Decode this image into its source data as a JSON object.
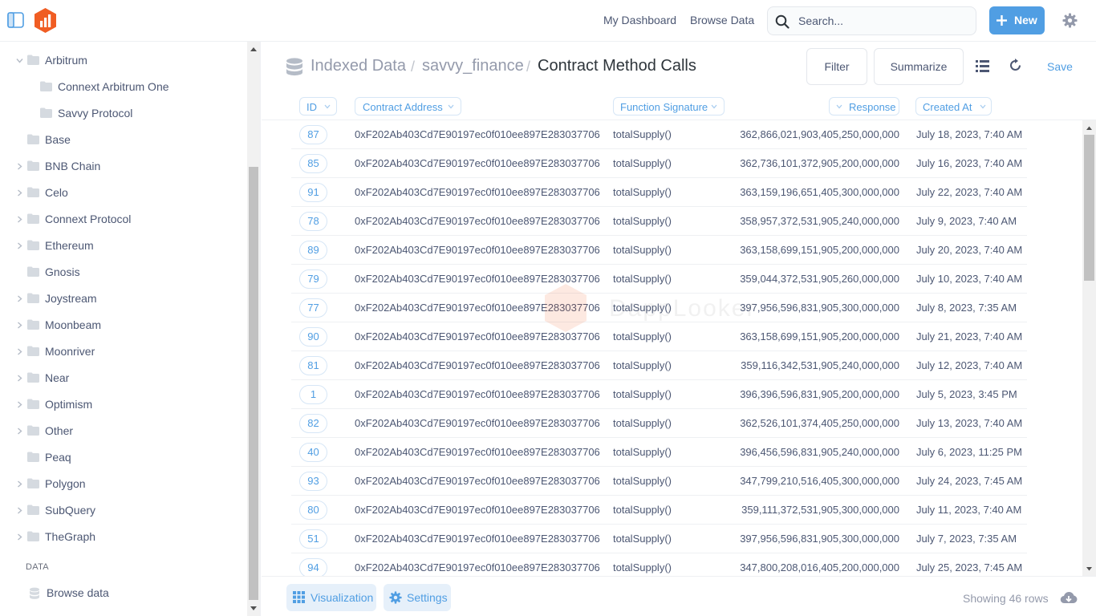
{
  "topbar": {
    "nav": [
      "My Dashboard",
      "Browse Data"
    ],
    "search_placeholder": "Search...",
    "new_label": "New",
    "brand_color": "#509ee3",
    "logo_color": "#f05d23"
  },
  "sidebar": {
    "items": [
      {
        "label": "Arbitrum",
        "expanded": true,
        "has_children": true,
        "level": 0
      },
      {
        "label": "Connext Arbitrum One",
        "has_children": false,
        "level": 1
      },
      {
        "label": "Savvy Protocol",
        "has_children": false,
        "level": 1
      },
      {
        "label": "Base",
        "has_children": false,
        "level": 0
      },
      {
        "label": "BNB Chain",
        "has_children": true,
        "level": 0
      },
      {
        "label": "Celo",
        "has_children": true,
        "level": 0
      },
      {
        "label": "Connext Protocol",
        "has_children": true,
        "level": 0
      },
      {
        "label": "Ethereum",
        "has_children": true,
        "level": 0
      },
      {
        "label": "Gnosis",
        "has_children": false,
        "level": 0
      },
      {
        "label": "Joystream",
        "has_children": true,
        "level": 0
      },
      {
        "label": "Moonbeam",
        "has_children": true,
        "level": 0
      },
      {
        "label": "Moonriver",
        "has_children": true,
        "level": 0
      },
      {
        "label": "Near",
        "has_children": true,
        "level": 0
      },
      {
        "label": "Optimism",
        "has_children": true,
        "level": 0
      },
      {
        "label": "Other",
        "has_children": true,
        "level": 0
      },
      {
        "label": "Peaq",
        "has_children": false,
        "level": 0
      },
      {
        "label": "Polygon",
        "has_children": true,
        "level": 0
      },
      {
        "label": "SubQuery",
        "has_children": true,
        "level": 0
      },
      {
        "label": "TheGraph",
        "has_children": true,
        "level": 0
      }
    ],
    "section_label": "DATA",
    "browse_label": "Browse data"
  },
  "header": {
    "crumbs": [
      "Indexed Data",
      "savvy_finance"
    ],
    "separator": "/",
    "current": "Contract Method Calls",
    "filter_label": "Filter",
    "summarize_label": "Summarize",
    "save_label": "Save"
  },
  "table": {
    "columns": [
      "ID",
      "Contract Address",
      "Function Signature",
      "Response",
      "Created At"
    ],
    "rows": [
      [
        "87",
        "0xF202Ab403Cd7E90197ec0f010ee897E283037706",
        "totalSupply()",
        "362,866,021,903,405,250,000,000",
        "July 18, 2023, 7:40 AM"
      ],
      [
        "85",
        "0xF202Ab403Cd7E90197ec0f010ee897E283037706",
        "totalSupply()",
        "362,736,101,372,905,200,000,000",
        "July 16, 2023, 7:40 AM"
      ],
      [
        "91",
        "0xF202Ab403Cd7E90197ec0f010ee897E283037706",
        "totalSupply()",
        "363,159,196,651,405,300,000,000",
        "July 22, 2023, 7:40 AM"
      ],
      [
        "78",
        "0xF202Ab403Cd7E90197ec0f010ee897E283037706",
        "totalSupply()",
        "358,957,372,531,905,240,000,000",
        "July 9, 2023, 7:40 AM"
      ],
      [
        "89",
        "0xF202Ab403Cd7E90197ec0f010ee897E283037706",
        "totalSupply()",
        "363,158,699,151,905,200,000,000",
        "July 20, 2023, 7:40 AM"
      ],
      [
        "79",
        "0xF202Ab403Cd7E90197ec0f010ee897E283037706",
        "totalSupply()",
        "359,044,372,531,905,260,000,000",
        "July 10, 2023, 7:40 AM"
      ],
      [
        "77",
        "0xF202Ab403Cd7E90197ec0f010ee897E283037706",
        "totalSupply()",
        "397,956,596,831,905,300,000,000",
        "July 8, 2023, 7:35 AM"
      ],
      [
        "90",
        "0xF202Ab403Cd7E90197ec0f010ee897E283037706",
        "totalSupply()",
        "363,158,699,151,905,200,000,000",
        "July 21, 2023, 7:40 AM"
      ],
      [
        "81",
        "0xF202Ab403Cd7E90197ec0f010ee897E283037706",
        "totalSupply()",
        "359,116,342,531,905,240,000,000",
        "July 12, 2023, 7:40 AM"
      ],
      [
        "1",
        "0xF202Ab403Cd7E90197ec0f010ee897E283037706",
        "totalSupply()",
        "396,396,596,831,905,200,000,000",
        "July 5, 2023, 3:45 PM"
      ],
      [
        "82",
        "0xF202Ab403Cd7E90197ec0f010ee897E283037706",
        "totalSupply()",
        "362,526,101,374,405,250,000,000",
        "July 13, 2023, 7:40 AM"
      ],
      [
        "40",
        "0xF202Ab403Cd7E90197ec0f010ee897E283037706",
        "totalSupply()",
        "396,456,596,831,905,240,000,000",
        "July 6, 2023, 11:25 PM"
      ],
      [
        "93",
        "0xF202Ab403Cd7E90197ec0f010ee897E283037706",
        "totalSupply()",
        "347,799,210,516,405,300,000,000",
        "July 24, 2023, 7:45 AM"
      ],
      [
        "80",
        "0xF202Ab403Cd7E90197ec0f010ee897E283037706",
        "totalSupply()",
        "359,111,372,531,905,300,000,000",
        "July 11, 2023, 7:40 AM"
      ],
      [
        "51",
        "0xF202Ab403Cd7E90197ec0f010ee897E283037706",
        "totalSupply()",
        "397,956,596,831,905,300,000,000",
        "July 7, 2023, 7:35 AM"
      ],
      [
        "94",
        "0xF202Ab403Cd7E90197ec0f010ee897E283037706",
        "totalSupply()",
        "347,800,208,016,405,200,000,000",
        "July 25, 2023, 7:45 AM"
      ]
    ]
  },
  "watermark": "DappLooker",
  "footer": {
    "visualization_label": "Visualization",
    "settings_label": "Settings",
    "row_count": "Showing 46 rows"
  }
}
